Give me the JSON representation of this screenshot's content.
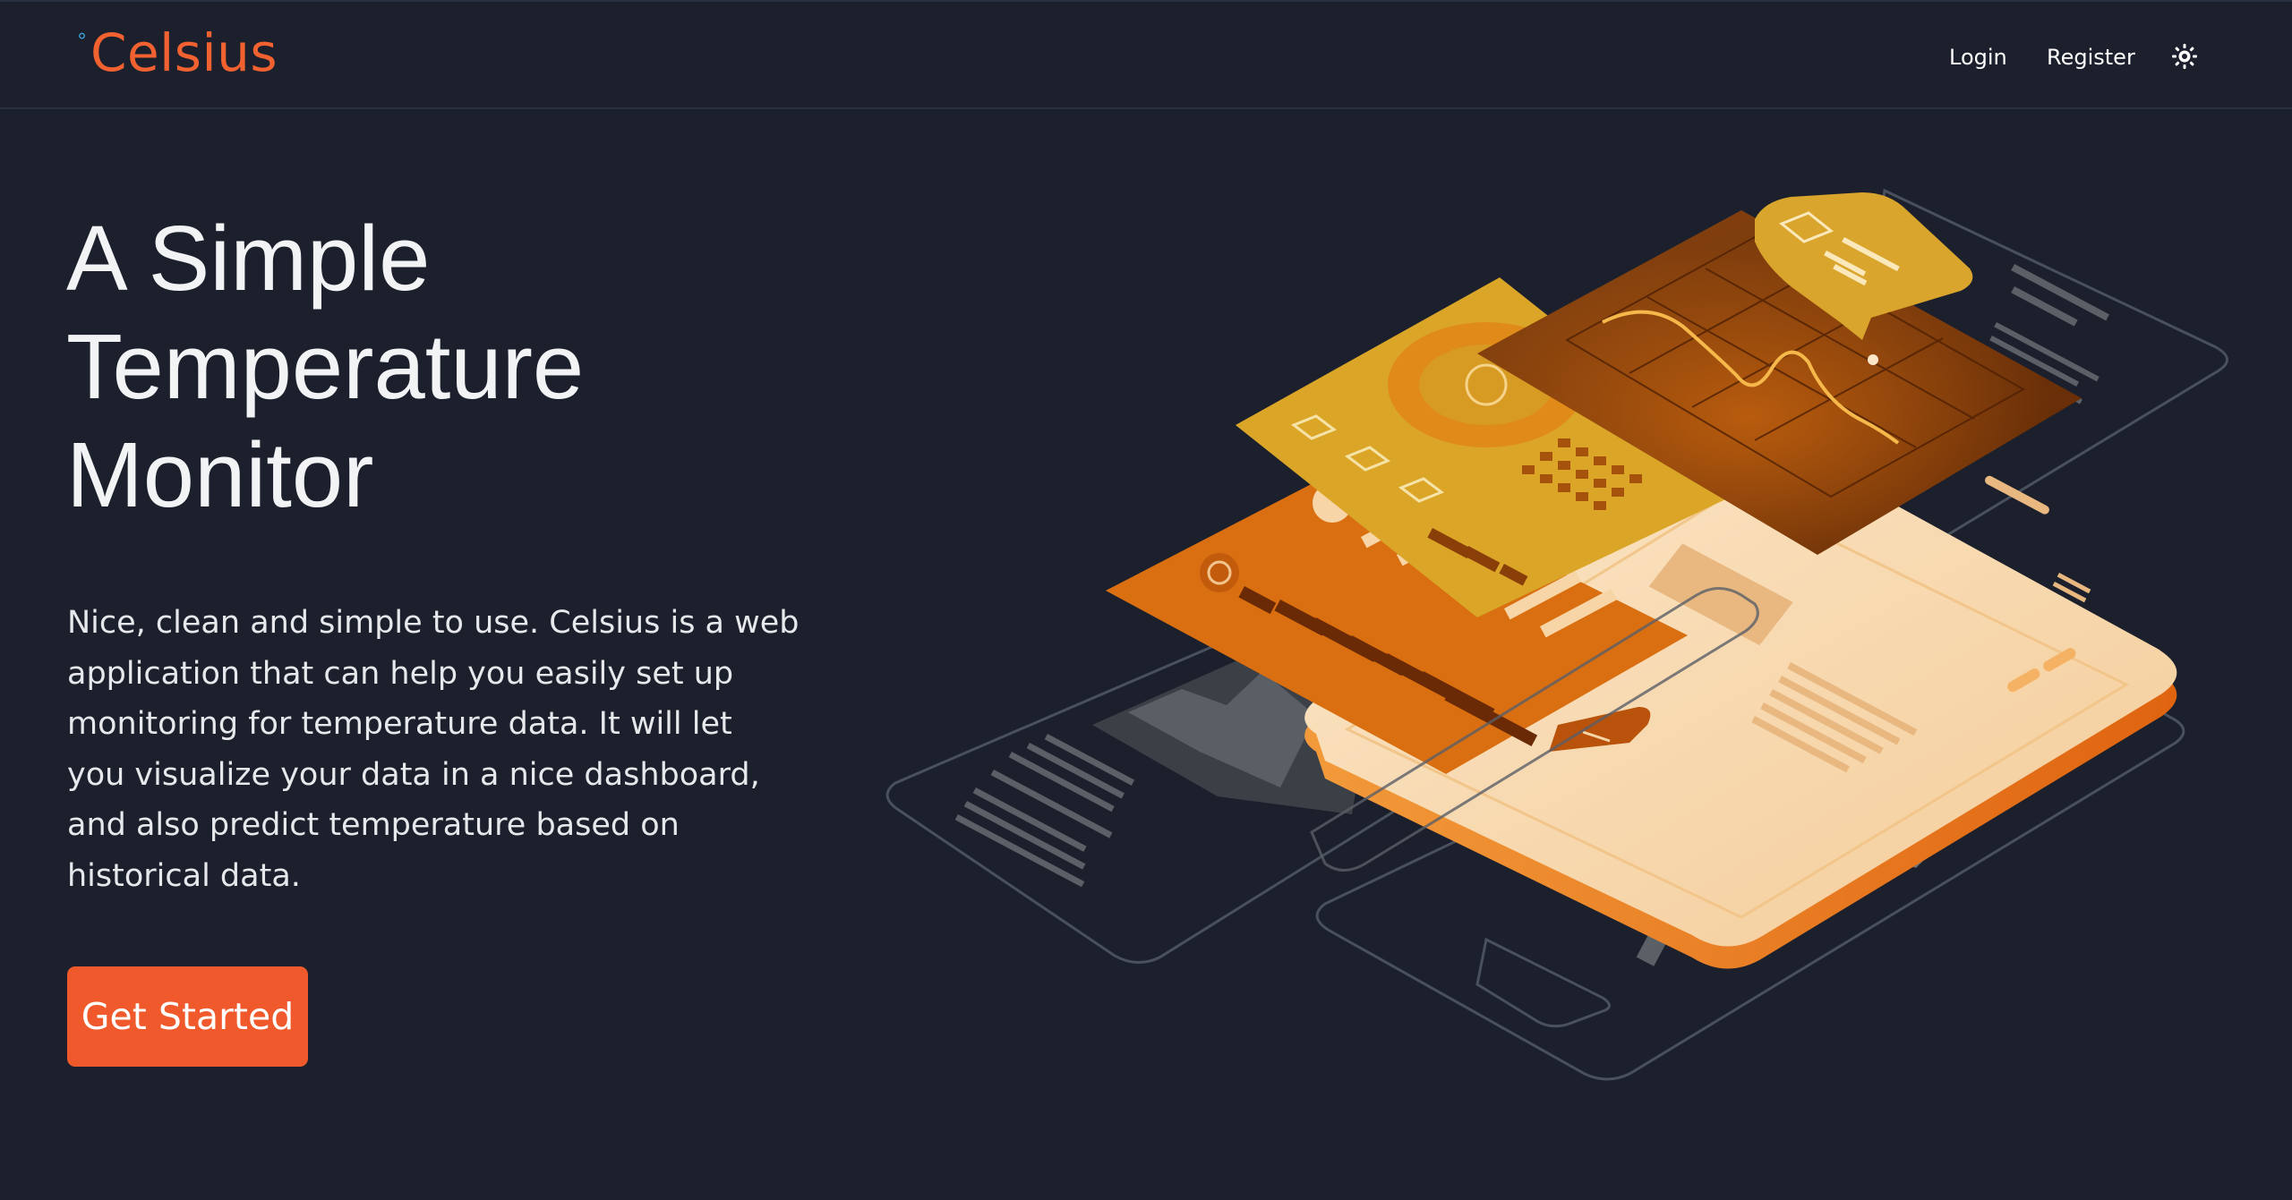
{
  "brand": {
    "degree": "°",
    "name": "Celsius"
  },
  "nav": {
    "login": "Login",
    "register": "Register",
    "theme_icon": "sun-icon"
  },
  "hero": {
    "title_lines": [
      "A Simple",
      "Temperature",
      "Monitor"
    ],
    "description_lines": [
      "Nice, clean and simple to use. Celsius is a web",
      "application that can help you easily set up",
      "monitoring for temperature data. It will let",
      "you visualize your data in a nice dashboard,",
      "and also predict temperature based on",
      "historical data."
    ],
    "cta_label": "Get Started"
  },
  "illustration": {
    "icon": "isometric-dashboard-illustration",
    "colors": {
      "phone_body": "#f7d9b0",
      "phone_edge": "#e8701c",
      "panel_orange": "#d9700f",
      "panel_gold": "#dba82a",
      "panel_brown": "#7a3608",
      "outline": "#4a505c"
    }
  },
  "colors": {
    "background": "#1b202c",
    "accent": "#f0592b",
    "brand": "#f26130",
    "degree": "#3b9fd6",
    "text": "#f2f3f5"
  }
}
